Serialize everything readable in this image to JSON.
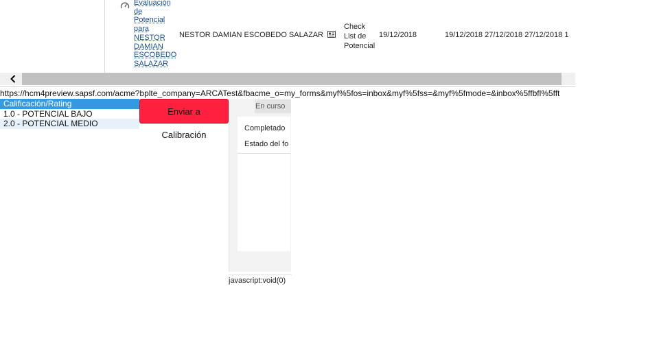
{
  "table_row": {
    "form_link_lines": [
      "Evaluación",
      "de",
      "Potencial",
      "para",
      "NESTOR",
      "DAMIAN",
      "ESCOBEDO",
      "SALAZAR"
    ],
    "subject_name": "NESTOR DAMIAN ESCOBEDO SALAZAR",
    "step_lines": [
      "Check",
      "List de",
      "Potencial"
    ],
    "step_date": "19/12/2018",
    "dates_overflow": "19/12/2018 27/12/2018 27/12/2018 1",
    "icons": [
      "gauge-icon",
      "person-card-icon"
    ]
  },
  "scrollbar": {
    "icon": "chevron-left-icon"
  },
  "status_url": "https://hcm4preview.sapsf.com/acme?bplte_company=ARCATest&fbacme_o=my_forms&myf%5fos=inbox&myf%5fss=&myf%5fmode=&inbox%5ffbfl%5fft",
  "rating_dropdown": {
    "options": [
      "Calificación/Rating",
      "1.0 - POTENCIAL BAJO",
      "2.0 - POTENCIAL MEDIO"
    ]
  },
  "calibration_button": "Enviar a Calibración",
  "side_panel": {
    "tab_label": "En curso",
    "completed_label": "Completado",
    "form_status_label": "Estado del fo"
  },
  "link_status": "javascript:void(0)",
  "colors": {
    "rating_header_bg": "#3399e0",
    "calibration_button_bg": "#ff2040",
    "link_color": "#1a4f88"
  }
}
